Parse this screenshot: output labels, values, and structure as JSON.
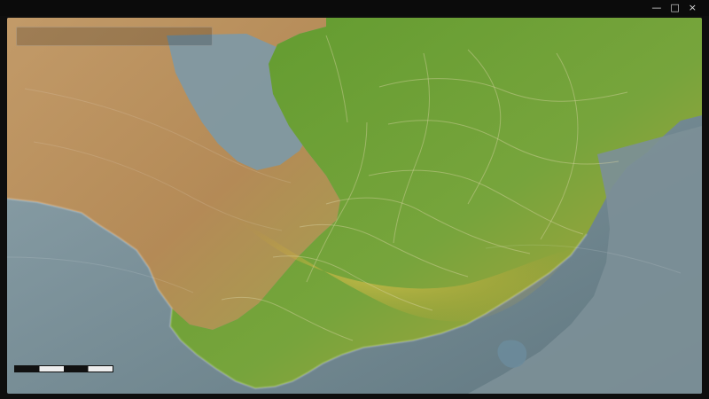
{
  "window": {
    "menu_text": "",
    "center_title": "",
    "controls": [
      "—",
      "□",
      "×"
    ]
  },
  "map": {
    "top_panel": {
      "label": "",
      "coords": ""
    },
    "scale": {
      "text": ""
    },
    "labels": [
      {
        "id": "land-north-left",
        "text": ""
      },
      {
        "id": "land-west-mid",
        "text": ""
      },
      {
        "id": "land-west-lower",
        "text": ""
      },
      {
        "id": "sea-center",
        "text": ""
      },
      {
        "id": "center-1",
        "text": ""
      },
      {
        "id": "center-2",
        "text": ""
      },
      {
        "id": "east-1",
        "text": ""
      },
      {
        "id": "east-2",
        "text": ""
      },
      {
        "id": "east-3",
        "text": ""
      },
      {
        "id": "south-1",
        "text": ""
      },
      {
        "id": "south-2",
        "text": ""
      },
      {
        "id": "south-3",
        "text": ""
      },
      {
        "id": "west-coast",
        "text": ""
      },
      {
        "id": "south-east-water",
        "text": ""
      }
    ]
  },
  "colors": {
    "sea": "#7c8f97",
    "land_west": "#b88d5b",
    "land_mid": "#a9a44c",
    "land_green": "#6fa12e",
    "land_gold": "#c2a43a",
    "border_line": "#d6d2a2"
  }
}
